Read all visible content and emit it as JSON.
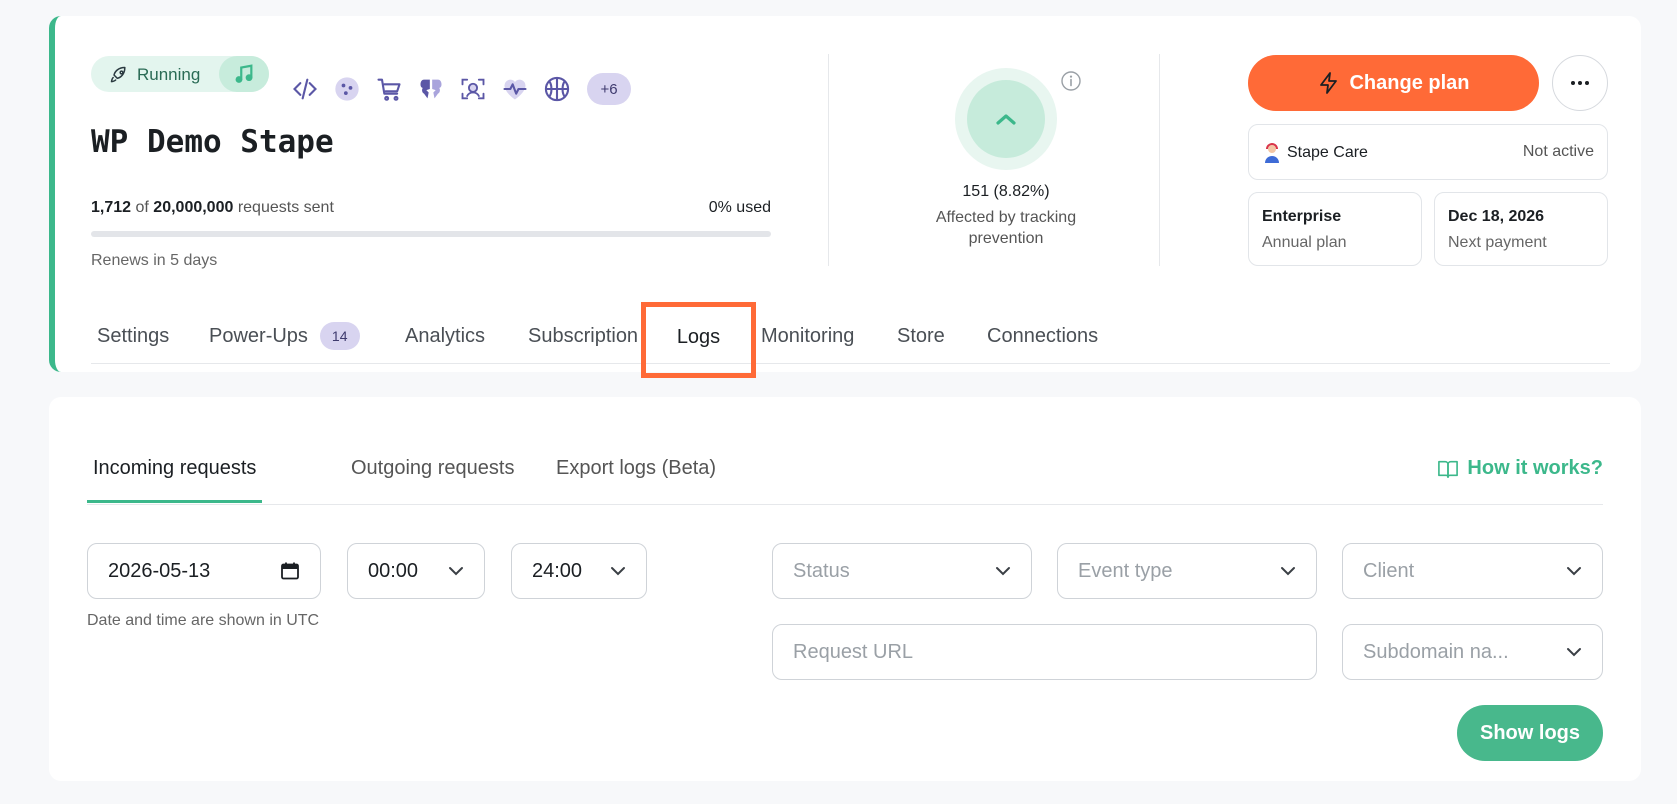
{
  "header": {
    "status_label": "Running",
    "more_integrations": "+6",
    "container_name": "WP Demo Stape",
    "usage": {
      "sent": "1,712",
      "of": "of",
      "limit": "20,000,000",
      "suffix": "requests sent",
      "used_percent": 0,
      "used_label": "0% used"
    },
    "renews_label": "Renews in 5 days",
    "icons": [
      "code-icon",
      "cookie-icon",
      "cart-icon",
      "brain-icon",
      "face-scan-icon",
      "heartbeat-icon",
      "basketball-icon"
    ]
  },
  "tracking": {
    "value": "151 (8.82%)",
    "label": "Affected by tracking prevention"
  },
  "plan": {
    "change_plan_label": "Change plan",
    "stape_care_label": "Stape Care",
    "stape_care_value": "Not active",
    "plan_name": "Enterprise",
    "plan_type": "Annual plan",
    "next_payment_date": "Dec 18, 2026",
    "next_payment_label": "Next payment"
  },
  "tabs": {
    "settings": "Settings",
    "powerups": "Power-Ups",
    "powerups_count": "14",
    "analytics": "Analytics",
    "subscription": "Subscription",
    "logs": "Logs",
    "monitoring": "Monitoring",
    "store": "Store",
    "connections": "Connections"
  },
  "logs": {
    "sub_tabs": {
      "incoming": "Incoming requests",
      "outgoing": "Outgoing requests",
      "export": "Export logs (Beta)"
    },
    "how_it_works": "How it works?",
    "date_value": "2026-05-13",
    "time_from": "00:00",
    "time_to": "24:00",
    "utc_hint": "Date and time are shown in UTC",
    "status_placeholder": "Status",
    "event_type_placeholder": "Event type",
    "client_placeholder": "Client",
    "request_url_placeholder": "Request URL",
    "subdomain_placeholder": "Subdomain na...",
    "show_logs_label": "Show logs"
  },
  "colors": {
    "accent_green": "#3cb88b",
    "accent_orange": "#ff6a37",
    "badge_purple": "#d8d4f0"
  }
}
